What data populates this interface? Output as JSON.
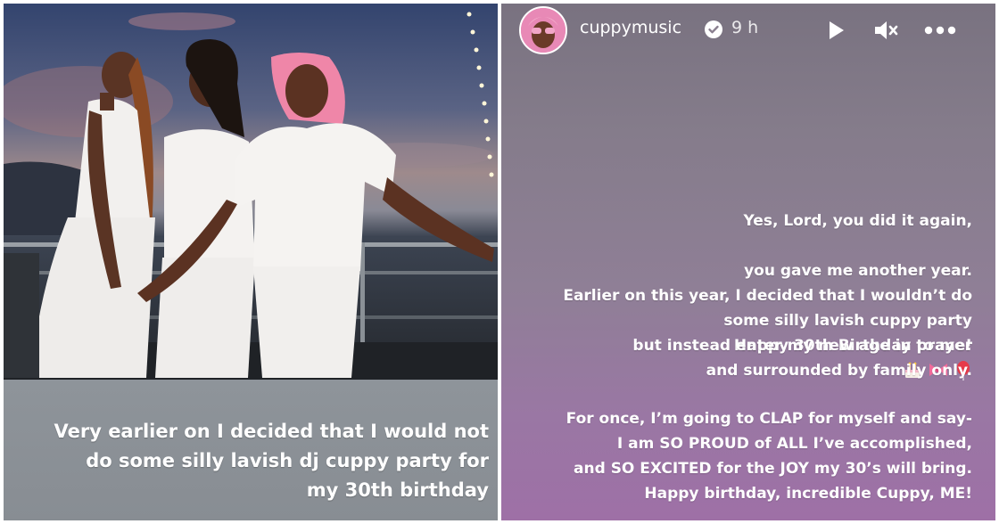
{
  "left": {
    "caption": "Very earlier on I decided that I would not\ndo some silly lavish dj cuppy party for\nmy 30th birthday"
  },
  "right": {
    "header": {
      "username": "cuppymusic",
      "time": "9 h"
    },
    "paragraphs": {
      "p1_line1": "Yes, Lord, you did it again,",
      "p1_line2": "you gave me another year.",
      "p1_line3": "Happy 30th Birthday to me!",
      "p2": "Earlier on this year, I decided that I wouldn’t do\nsome silly lavish cuppy party\nbut instead enter my new age in prayer\nand surrounded by family only.",
      "p3": "For once, I’m going to CLAP for myself and say-\nI am SO PROUD of ALL I’ve accomplished,\nand SO EXCITED for the JOY my 30’s will bring.\nHappy birthday, incredible Cuppy, ME!"
    },
    "emojis": [
      "cake-icon",
      "ribbon-icon",
      "balloon-icon"
    ]
  },
  "colors": {
    "pink_hair": "#f08cb0",
    "dress_white": "#f4f2f0",
    "sky_top": "#3a4a72"
  }
}
